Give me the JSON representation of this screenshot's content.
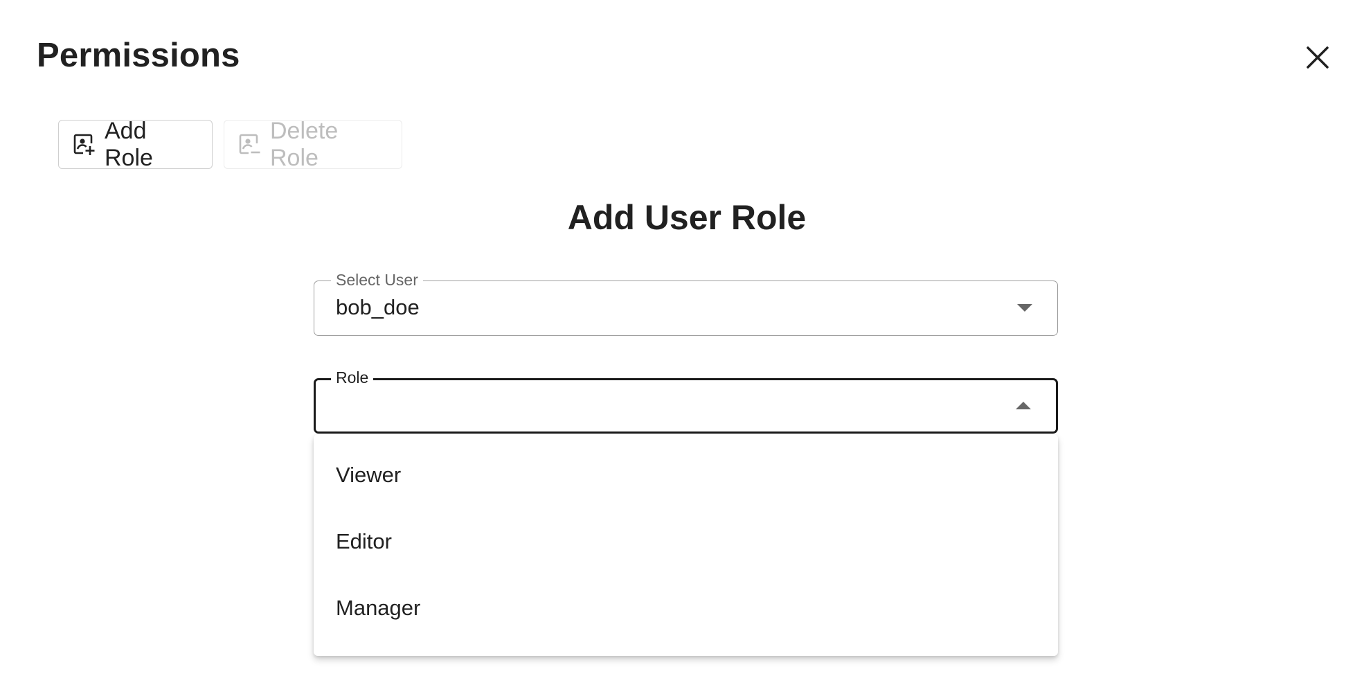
{
  "dialog": {
    "title": "Permissions",
    "close_icon": "close-icon"
  },
  "toolbar": {
    "add_role_label": "Add Role",
    "add_role_icon": "person-add-icon",
    "delete_role_label": "Delete Role",
    "delete_role_icon": "person-remove-icon",
    "delete_role_disabled": true
  },
  "form": {
    "title": "Add User Role",
    "select_user": {
      "label": "Select User",
      "value": "bob_doe"
    },
    "role": {
      "label": "Role",
      "value": "",
      "open": true,
      "options": [
        "Viewer",
        "Editor",
        "Manager"
      ]
    }
  },
  "colors": {
    "text": "#212121",
    "disabled_text": "#bdbdbd",
    "border": "#9e9e9e",
    "focused_border": "#1a1a1a"
  }
}
